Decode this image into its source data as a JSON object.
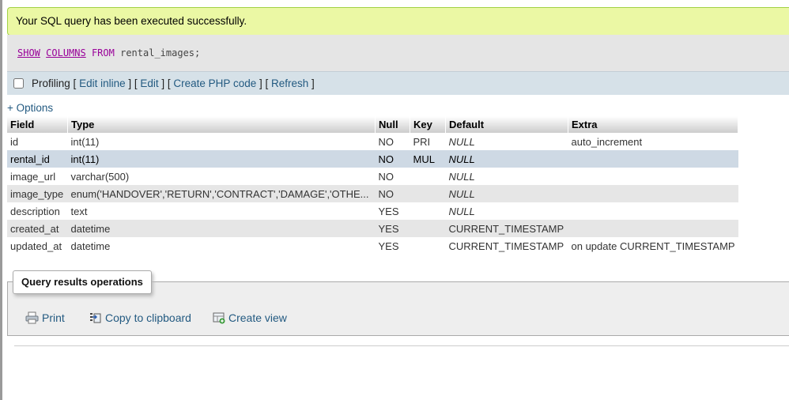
{
  "success_message": "Your SQL query has been executed successfully.",
  "sql": {
    "kw1": "SHOW",
    "kw2": "COLUMNS",
    "kw3": "FROM",
    "table": "rental_images;"
  },
  "toolbar": {
    "profiling": "Profiling",
    "edit_inline": "Edit inline",
    "edit": "Edit",
    "create_php": "Create PHP code",
    "refresh": "Refresh"
  },
  "options_link": "+ Options",
  "columns": [
    "Field",
    "Type",
    "Null",
    "Key",
    "Default",
    "Extra"
  ],
  "rows": [
    {
      "field": "id",
      "type": "int(11)",
      "null": "NO",
      "key": "PRI",
      "default": "NULL",
      "extra": "auto_increment"
    },
    {
      "field": "rental_id",
      "type": "int(11)",
      "null": "NO",
      "key": "MUL",
      "default": "NULL",
      "extra": ""
    },
    {
      "field": "image_url",
      "type": "varchar(500)",
      "null": "NO",
      "key": "",
      "default": "NULL",
      "extra": ""
    },
    {
      "field": "image_type",
      "type": "enum('HANDOVER','RETURN','CONTRACT','DAMAGE','OTHE...",
      "null": "NO",
      "key": "",
      "default": "NULL",
      "extra": ""
    },
    {
      "field": "description",
      "type": "text",
      "null": "YES",
      "key": "",
      "default": "NULL",
      "extra": ""
    },
    {
      "field": "created_at",
      "type": "datetime",
      "null": "YES",
      "key": "",
      "default": "CURRENT_TIMESTAMP",
      "extra": ""
    },
    {
      "field": "updated_at",
      "type": "datetime",
      "null": "YES",
      "key": "",
      "default": "CURRENT_TIMESTAMP",
      "extra": "on update CURRENT_TIMESTAMP"
    }
  ],
  "query_ops": {
    "legend": "Query results operations",
    "print": "Print",
    "copy": "Copy to clipboard",
    "create_view": "Create view",
    "icons": [
      "printer-icon",
      "clipboard-icon",
      "create-view-icon"
    ]
  },
  "colors": {
    "success_bg": "#ebf8a4",
    "link": "#235a81",
    "highlight_row": "#ced9e4"
  }
}
